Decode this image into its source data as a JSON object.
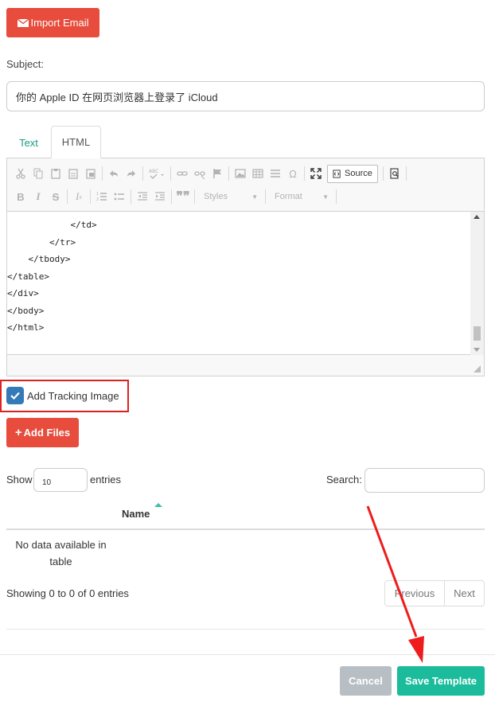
{
  "import_button": {
    "label": "Import Email",
    "icon": "envelope-icon"
  },
  "subject": {
    "label": "Subject:",
    "value": "你的 Apple ID 在网页浏览器上登录了 iCloud"
  },
  "tabs": [
    {
      "label": "Text"
    },
    {
      "label": "HTML"
    }
  ],
  "editor": {
    "source_label": "Source",
    "styles_label": "Styles",
    "format_label": "Format",
    "code_lines": [
      "            </td>",
      "        </tr>",
      "    </tbody>",
      "</table>",
      "</div>",
      "</body>",
      "</html>"
    ]
  },
  "tracking": {
    "label": "Add Tracking Image",
    "checked": true
  },
  "add_files_button": {
    "label": "Add Files"
  },
  "table": {
    "show_label": "Show",
    "entries_value": "10",
    "entries_label": "entries",
    "search_label": "Search:",
    "column_name": "Name",
    "no_data": "No data available in table",
    "showing": "Showing 0 to 0 of 0 entries",
    "previous": "Previous",
    "next": "Next"
  },
  "footer": {
    "cancel_label": "Cancel",
    "save_label": "Save Template"
  },
  "colors": {
    "danger": "#e74c3c",
    "success": "#1abc9c",
    "primary": "#337ab7",
    "highlight": "#e02020"
  }
}
